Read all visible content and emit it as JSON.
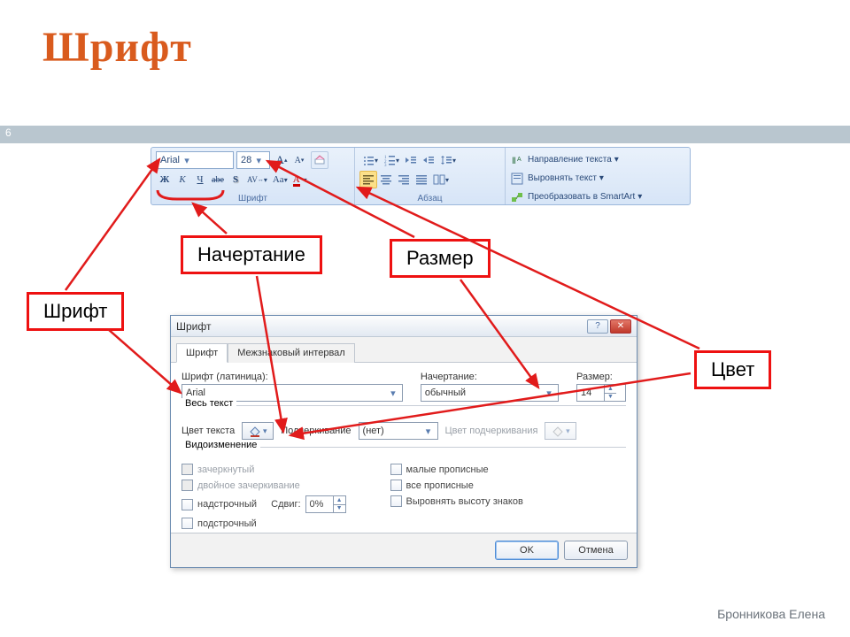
{
  "slide": {
    "title": "Шрифт",
    "page_number": "6",
    "author": "Бронникова Елена"
  },
  "callouts": {
    "font": "Шрифт",
    "style": "Начертание",
    "size": "Размер",
    "color": "Цвет"
  },
  "ribbon": {
    "font_name": "Arial",
    "font_size": "28",
    "group_font": "Шрифт",
    "group_para": "Абзац",
    "bold": "Ж",
    "italic": "К",
    "underline": "Ч",
    "strike": "abe",
    "shadow": "S",
    "char_spacing": "AV",
    "change_case": "Aa",
    "font_color": "A",
    "text_direction": "Направление текста",
    "align_text": "Выровнять текст",
    "convert_smartart": "Преобразовать в SmartArt"
  },
  "dialog": {
    "title": "Шрифт",
    "tab_font": "Шрифт",
    "tab_spacing": "Межзнаковый интервал",
    "latin_label": "Шрифт (латиница):",
    "latin_value": "Arial",
    "style_label": "Начертание:",
    "style_value": "обычный",
    "size_label": "Размер:",
    "size_value": "14",
    "all_text": "Весь текст",
    "text_color": "Цвет текста",
    "underline_label": "Подчеркивание",
    "underline_value": "(нет)",
    "underline_color": "Цвет подчеркивания",
    "effects_legend": "Видоизменение",
    "chk_strike": "зачеркнутый",
    "chk_dstrike": "двойное зачеркивание",
    "chk_super": "надстрочный",
    "chk_sub": "подстрочный",
    "offset_label": "Сдвиг:",
    "offset_value": "0%",
    "chk_smallcaps": "малые прописные",
    "chk_allcaps": "все прописные",
    "chk_equalize": "Выровнять высоту знаков",
    "btn_ok": "OK",
    "btn_cancel": "Отмена"
  },
  "colors": {
    "callout": "#e11b1b",
    "arrow": "#e11b1b"
  }
}
